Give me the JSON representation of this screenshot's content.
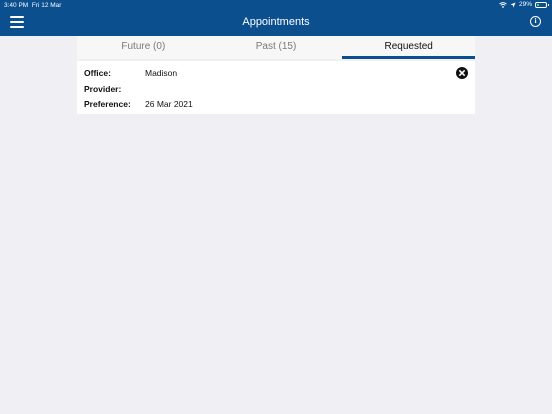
{
  "status_bar": {
    "time": "3:40 PM",
    "date": "Fri 12 Mar",
    "battery_text": "29%",
    "battery_level": 0.29
  },
  "header": {
    "title": "Appointments"
  },
  "tabs": [
    {
      "label": "Future (0)",
      "active": false
    },
    {
      "label": "Past (15)",
      "active": false
    },
    {
      "label": "Requested",
      "active": true
    }
  ],
  "request": {
    "office_label": "Office:",
    "office_value": "Madison",
    "provider_label": "Provider:",
    "provider_value": "",
    "preference_label": "Preference:",
    "preference_value": "26 Mar 2021"
  },
  "colors": {
    "brand": "#0b4f8f",
    "background": "#efeff4"
  }
}
